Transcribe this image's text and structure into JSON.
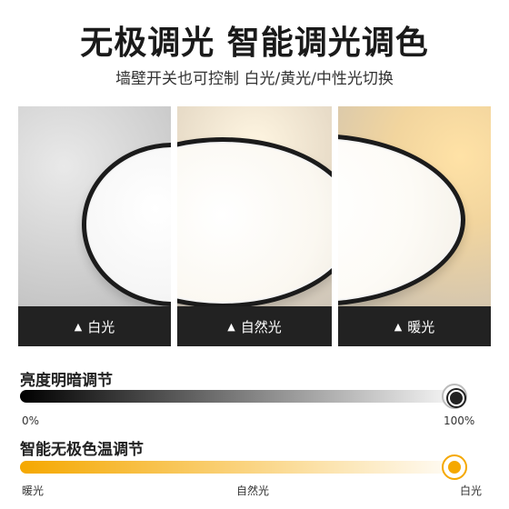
{
  "header": {
    "title": "无极调光 智能调光调色",
    "subtitle": "墙壁开关也可控制 白光/黄光/中性光切换"
  },
  "panels": [
    {
      "label": "白光",
      "icon": "triangle-up-icon"
    },
    {
      "label": "自然光",
      "icon": "triangle-up-icon"
    },
    {
      "label": "暖光",
      "icon": "triangle-up-icon"
    }
  ],
  "brightness": {
    "label": "亮度明暗调节",
    "min_label": "0%",
    "max_label": "100%",
    "level": 1.0,
    "colors": [
      "#000000",
      "#ffffff"
    ]
  },
  "color_temp": {
    "label": "智能无极色温调节",
    "left_label": "暖光",
    "mid_label": "自然光",
    "right_label": "白光",
    "level": 1.0,
    "colors": [
      "#f5a800",
      "#ffffff"
    ]
  },
  "triangle_glyph": "▲"
}
